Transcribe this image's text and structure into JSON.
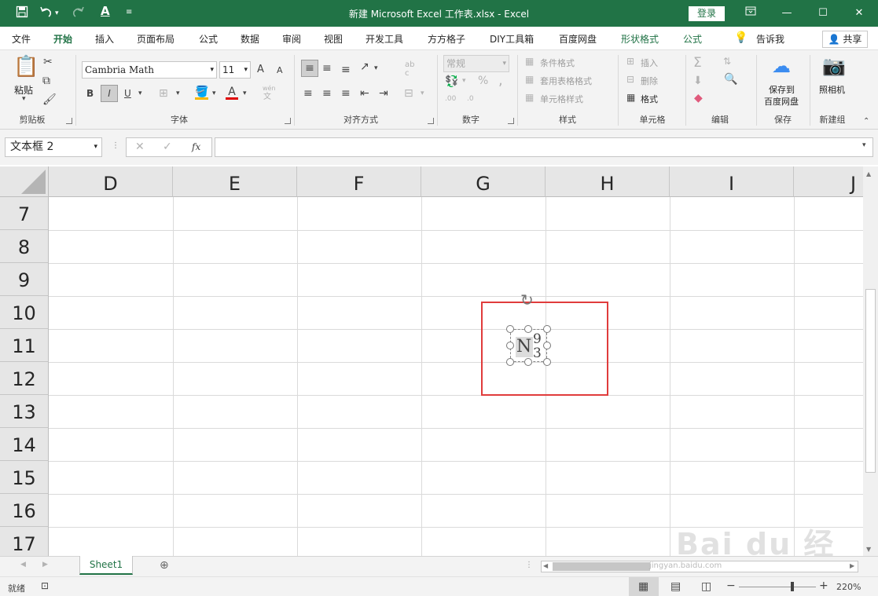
{
  "window": {
    "title": "新建 Microsoft Excel 工作表.xlsx  -  Excel",
    "login_label": "登录",
    "qa_save_icon": "save-icon",
    "qa_undo_icon": "undo-icon",
    "qa_redo_icon": "redo-icon",
    "qa_font_icon": "font-color-icon"
  },
  "tabs": [
    "文件",
    "开始",
    "插入",
    "页面布局",
    "公式",
    "数据",
    "审阅",
    "视图",
    "开发工具",
    "方方格子",
    "DIY工具箱",
    "百度网盘",
    "形状格式",
    "公式",
    "告诉我"
  ],
  "active_tab": "开始",
  "share_label": "共享",
  "ribbon": {
    "clipboard": {
      "paste": "粘贴",
      "group": "剪贴板"
    },
    "font": {
      "name": "Cambria Math",
      "size": "11",
      "bold": "B",
      "italic": "I",
      "underline": "U",
      "grow": "A",
      "shrink": "A",
      "group": "字体",
      "wen": "wén",
      "wen2": "文"
    },
    "align": {
      "group": "对齐方式",
      "ab": "ab",
      "c": "c"
    },
    "number": {
      "format": "常规",
      "percent": "%",
      "comma": ",",
      "dec_inc": ".00",
      "dec_dec": ".0",
      "group": "数字"
    },
    "styles": {
      "cond": "条件格式",
      "table": "套用表格格式",
      "cell": "单元格样式",
      "group": "样式"
    },
    "cells": {
      "insert": "插入",
      "delete": "删除",
      "format": "格式",
      "group": "单元格"
    },
    "edit": {
      "group": "编辑"
    },
    "save": {
      "label1": "保存到",
      "label2": "百度网盘",
      "group": "保存"
    },
    "camera": {
      "label": "照相机",
      "group": "新建组"
    }
  },
  "formula_bar": {
    "name_box": "文本框 2",
    "fx": "fx",
    "value": ""
  },
  "columns": [
    "D",
    "E",
    "F",
    "G",
    "H",
    "I",
    "J"
  ],
  "rows": [
    "7",
    "8",
    "9",
    "10",
    "11",
    "12",
    "13",
    "14",
    "15",
    "16",
    "17"
  ],
  "equation": {
    "base": "N",
    "sup": "9",
    "sub": "3"
  },
  "highlight_color": "#e03c3c",
  "sheet": {
    "name": "Sheet1"
  },
  "status": {
    "ready": "就绪",
    "zoom": "220%"
  },
  "watermark": {
    "text": "Bai du 经验",
    "url": "jingyan.baidu.com"
  }
}
